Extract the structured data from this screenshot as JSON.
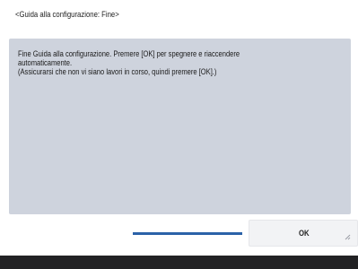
{
  "header": {
    "title": "<Guida alla configurazione: Fine>"
  },
  "message": {
    "line1": "Fine Guida alla configurazione. Premere [OK] per spegnere e riaccendere",
    "line2": "automaticamente.",
    "line3": "(Assicurarsi che non vi siano lavori in corso, quindi premere [OK].)"
  },
  "actions": {
    "ok_label": "OK"
  },
  "colors": {
    "panel": "#ced3dd",
    "progress": "#2b62a8",
    "bottom_bar": "#222224"
  },
  "icons": {
    "ok_corner": "resize-corner-icon"
  }
}
